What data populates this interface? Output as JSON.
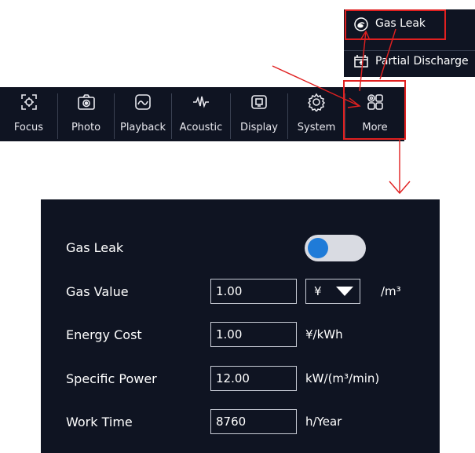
{
  "toolbar": {
    "items": [
      {
        "label": "Focus",
        "icon": "focus-icon"
      },
      {
        "label": "Photo",
        "icon": "camera-icon"
      },
      {
        "label": "Playback",
        "icon": "playback-icon"
      },
      {
        "label": "Acoustic",
        "icon": "waveform-icon"
      },
      {
        "label": "Display",
        "icon": "display-icon"
      },
      {
        "label": "System",
        "icon": "gear-icon"
      },
      {
        "label": "More",
        "icon": "grid-icon"
      }
    ]
  },
  "more_menu": {
    "items": [
      {
        "label": "Gas Leak",
        "icon": "gas-leak-icon"
      },
      {
        "label": "Partial Discharge",
        "icon": "battery-icon"
      }
    ]
  },
  "panel": {
    "gas_leak": {
      "label": "Gas Leak",
      "enabled": true
    },
    "gas_value": {
      "label": "Gas Value",
      "value": "1.00",
      "currency": "¥",
      "unit": "/m³"
    },
    "energy_cost": {
      "label": "Energy Cost",
      "value": "1.00",
      "unit": "¥/kWh"
    },
    "specific_power": {
      "label": "Specific Power",
      "value": "12.00",
      "unit": "kW/(m³/min)"
    },
    "work_time": {
      "label": "Work Time",
      "value": "8760",
      "unit": "h/Year"
    }
  },
  "colors": {
    "background": "#0f1422",
    "highlight": "#e02020",
    "toggle_knob": "#1f7bd8",
    "toggle_track": "#d9dbe2"
  }
}
